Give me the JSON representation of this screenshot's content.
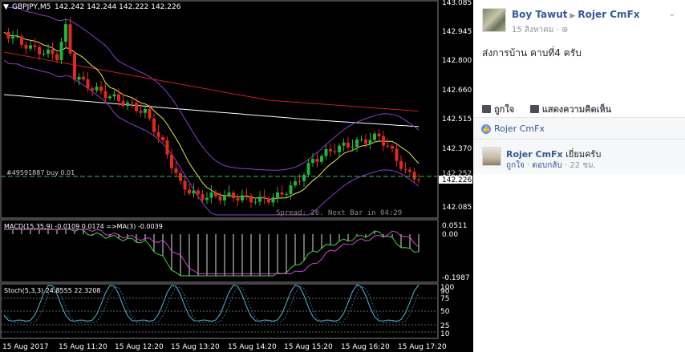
{
  "chart": {
    "header": {
      "symbol": "GBPJPY,M5",
      "prices": "142.242 142.244 142.222 142.226"
    },
    "order_label": "#49591887 buy 0.01",
    "spread_text": "Spread: 26. Next Bar in 04:29",
    "price_axis": {
      "ticks": [
        "143.085",
        "142.945",
        "142.800",
        "142.660",
        "142.515",
        "142.370",
        "142.085"
      ],
      "order_price": "142.252",
      "current_price": "142.226"
    },
    "macd": {
      "label": "MACD(15,35,9) -0.0109 0.0174  =>MA(3) -0.0039",
      "ticks": [
        "0.0511",
        "0.00",
        "-0.1987"
      ]
    },
    "stoch": {
      "label": "Stoch(5,3,3) 24.8555 22.3208",
      "ticks": [
        "100",
        "90",
        "75",
        "50",
        "25",
        "10"
      ]
    },
    "time_axis": [
      "15 Aug 2017",
      "15 Aug 11:20",
      "15 Aug 12:20",
      "15 Aug 13:20",
      "15 Aug 14:20",
      "15 Aug 15:20",
      "15 Aug 16:20",
      "15 Aug 17:20"
    ],
    "colors": {
      "bull": "#21b33a",
      "bear": "#e0281f",
      "ma_white": "#ffffff",
      "ma_red": "#c81e1e",
      "ma_yellow": "#e6e650",
      "bollinger": "#8a3fc8",
      "macd_signal": "#d244d2",
      "macd_main": "#48d048",
      "stoch_line": "#5ab4d2",
      "order_line": "#2ec05a"
    }
  },
  "post": {
    "author": "Boy Tawut",
    "target": "Rojer CmFx",
    "date": "15 สิงหาคม ·",
    "text": "ส่งการบ้าน คาบที่4 ครับ",
    "like_label": "ถูกใจ",
    "comment_label": "แสดงความคิดเห็น",
    "liker": "Rojer CmFx",
    "comment": {
      "author": "Rojer CmFx",
      "text": "เยี่ยมครับ",
      "like_label": "ถูกใจ",
      "reply_label": "ตอบกลับ",
      "time": "22 ชม."
    }
  }
}
